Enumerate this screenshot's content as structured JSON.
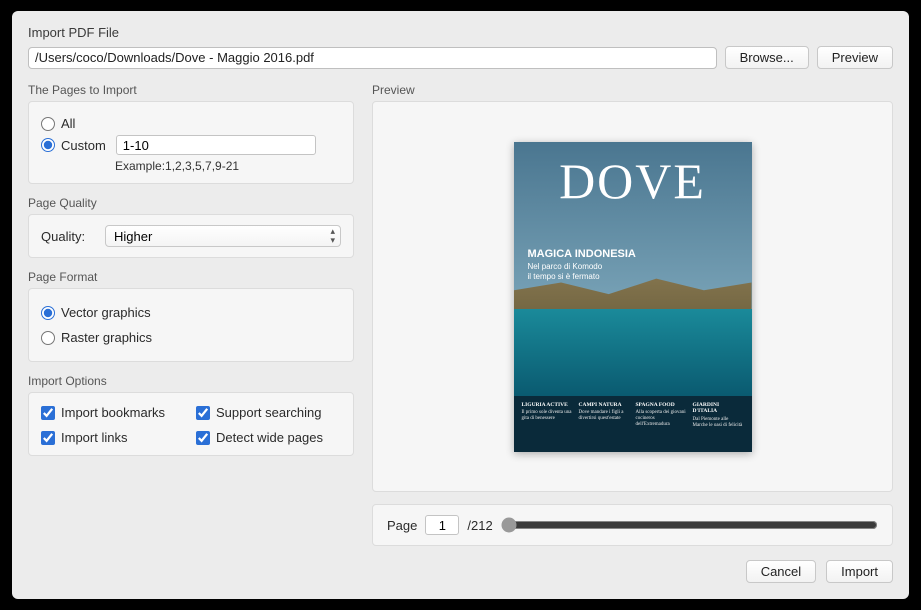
{
  "header": {
    "title": "Import PDF File"
  },
  "file": {
    "path": "/Users/coco/Downloads/Dove - Maggio 2016.pdf",
    "browse_label": "Browse...",
    "preview_label": "Preview"
  },
  "pages": {
    "group_label": "The Pages to Import",
    "all_label": "All",
    "custom_label": "Custom",
    "custom_value": "1-10",
    "example_label": "Example:1,2,3,5,7,9-21"
  },
  "quality": {
    "group_label": "Page Quality",
    "label": "Quality:",
    "value": "Higher"
  },
  "format": {
    "group_label": "Page Format",
    "vector_label": "Vector graphics",
    "raster_label": "Raster graphics"
  },
  "options": {
    "group_label": "Import Options",
    "bookmarks_label": "Import bookmarks",
    "searching_label": "Support searching",
    "links_label": "Import links",
    "wide_label": "Detect wide pages"
  },
  "preview": {
    "group_label": "Preview",
    "cover_title": "DOVE",
    "tagline": "MAGICA INDONESIA",
    "tagline2a": "Nel parco di Komodo",
    "tagline2b": "il tempo si è fermato",
    "cols": [
      {
        "h": "LIGURIA ACTIVE",
        "t": "Il primo sole diventa una gita di benessere"
      },
      {
        "h": "CAMPI NATURA",
        "t": "Dove mandare i figli a divertirsi quest'estate"
      },
      {
        "h": "SPAGNA FOOD",
        "t": "Alla scoperta dei giovani cocineros dell'Extremadura"
      },
      {
        "h": "GIARDINI D'ITALIA",
        "t": "Dal Piemonte alle Marche le oasi di felicità"
      }
    ]
  },
  "pager": {
    "page_label": "Page",
    "current": "1",
    "total": "/212"
  },
  "footer": {
    "cancel_label": "Cancel",
    "import_label": "Import"
  }
}
